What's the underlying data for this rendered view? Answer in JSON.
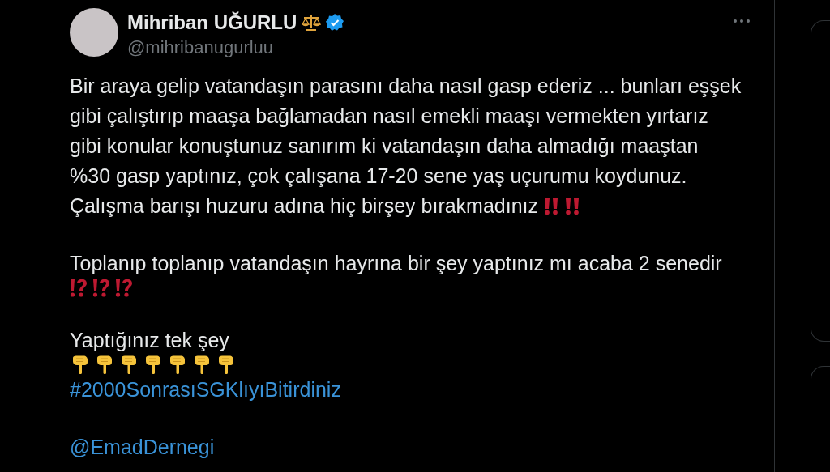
{
  "author": {
    "name": "Mihriban UĞURLU",
    "handle": "@mihribanugurluu",
    "verified": true
  },
  "post": {
    "paragraphs": [
      {
        "lines": [
          "Bir araya gelip vatandaşın parasını daha nasıl gasp ederiz ... bunları eşşek",
          "gibi çalıştırıp maaşa bağlamadan nasıl emekli maaşı vermekten yırtarız",
          "gibi konular konuştunuz sanırım ki vatandaşın daha almadığı maaştan",
          "%30 gasp yaptınız, çok çalışana 17-20 sene yaş uçurumu koydunuz.",
          "Çalışma barışı huzuru adına hiç birşey bırakmadınız"
        ],
        "emojis_inline": true,
        "emojis": [
          {
            "kind": "double-exclamation"
          },
          {
            "kind": "double-exclamation"
          }
        ]
      },
      {
        "lines": [
          "Toplanıp toplanıp vatandaşın hayrına bir şey yaptınız mı acaba 2 senedir"
        ],
        "emojis_inline": false,
        "emojis": [
          {
            "kind": "exclamation-question"
          },
          {
            "kind": "exclamation-question"
          },
          {
            "kind": "exclamation-question"
          }
        ]
      },
      {
        "lines": [
          "Yaptığınız tek şey"
        ],
        "emojis_inline": false,
        "emojis": [
          {
            "kind": "pointing-down"
          },
          {
            "kind": "pointing-down"
          },
          {
            "kind": "pointing-down"
          },
          {
            "kind": "pointing-down"
          },
          {
            "kind": "pointing-down"
          },
          {
            "kind": "pointing-down"
          },
          {
            "kind": "pointing-down"
          }
        ]
      }
    ],
    "hashtag": "#2000SonrasıSGKlıyıBitirdiniz",
    "mention": "@EmadDernegi"
  }
}
